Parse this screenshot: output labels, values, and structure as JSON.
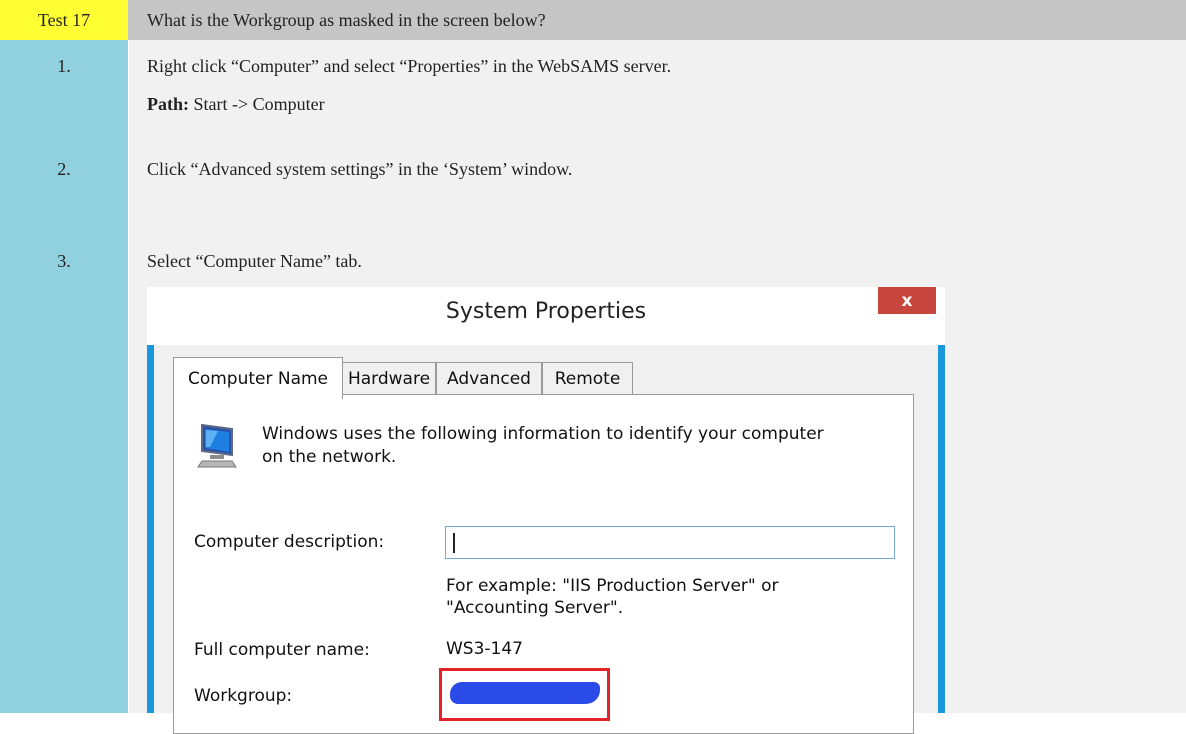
{
  "header": {
    "test_label": "Test 17",
    "question": "What is the Workgroup as masked in the screen below?"
  },
  "steps": [
    {
      "number": "1.",
      "text": "Right click “Computer” and select “Properties” in the WebSAMS server."
    },
    {
      "number": "2.",
      "text": "Click “Advanced system settings” in the ‘System’ window."
    },
    {
      "number": "3.",
      "text": "Select “Computer Name” tab."
    }
  ],
  "path": {
    "label": "Path:",
    "value": " Start -> Computer"
  },
  "dialog": {
    "title": "System Properties",
    "close_label": "x",
    "tabs": [
      "Computer Name",
      "Hardware",
      "Advanced",
      "Remote"
    ],
    "info_line1": "Windows uses the following information to identify your computer",
    "info_line2": "on the network.",
    "description_label": "Computer description:",
    "description_value": "",
    "example_line1": "For example: \"IIS Production Server\" or",
    "example_line2": "\"Accounting Server\".",
    "full_name_label": "Full computer name:",
    "full_name_value": "WS3-147",
    "workgroup_label": "Workgroup:",
    "workgroup_value_masked": true
  },
  "colors": {
    "test_cell": "#ffff33",
    "header_bg": "#c5c5c5",
    "left_column": "#91d0df",
    "right_column": "#f1f1f1",
    "window_border": "#1a96dc",
    "close_button": "#c7463d",
    "mask_outline": "#e52229",
    "mask_fill": "#2b4be8"
  }
}
